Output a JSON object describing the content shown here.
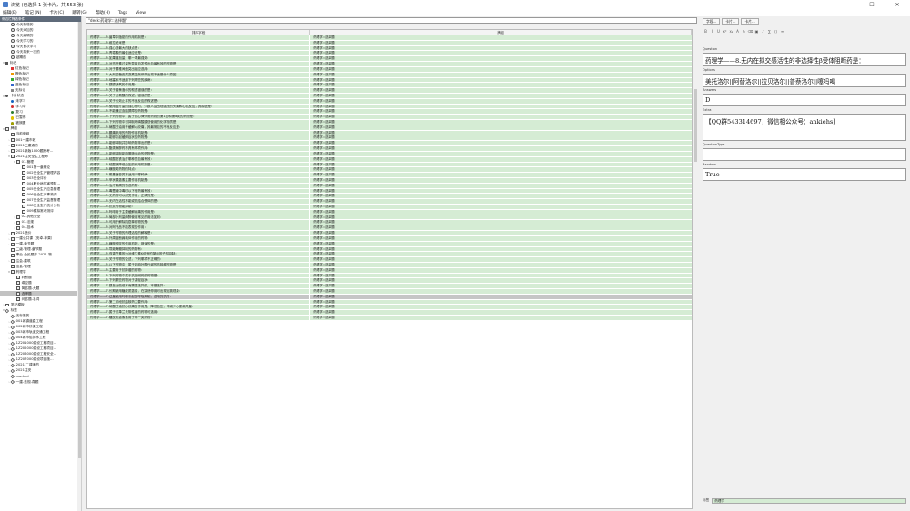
{
  "window": {
    "title": "浏览 (已选择 1 张卡片，共 553 张)",
    "min": "—",
    "max": "☐",
    "close": "✕"
  },
  "menu": [
    "编辑(E)",
    "笔记 (N)",
    "卡片(C)",
    "跳转(G)",
    "帮助(H)",
    "Tags",
    "View"
  ],
  "sidebar": {
    "header": "侧边栏筛选条件",
    "items": [
      {
        "label": "今天新增的",
        "indent": 1,
        "icon": "clock",
        "exp": ""
      },
      {
        "label": "今天添加的",
        "indent": 1,
        "icon": "clock",
        "exp": ""
      },
      {
        "label": "今天编辑的",
        "indent": 1,
        "icon": "clock",
        "exp": ""
      },
      {
        "label": "今天学习的",
        "indent": 1,
        "icon": "clock",
        "exp": ""
      },
      {
        "label": "今天首次学习",
        "indent": 1,
        "icon": "clock",
        "exp": ""
      },
      {
        "label": "今天再来一次的",
        "indent": 1,
        "icon": "clock",
        "exp": ""
      },
      {
        "label": "超期的",
        "indent": 1,
        "icon": "clock",
        "exp": ""
      },
      {
        "label": "标记",
        "indent": 0,
        "icon": "flag",
        "exp": "▾"
      },
      {
        "label": "红色标记",
        "indent": 1,
        "icon": "flag",
        "exp": "",
        "color": "#d33"
      },
      {
        "label": "橙色标记",
        "indent": 1,
        "icon": "flag",
        "exp": "",
        "color": "#e90"
      },
      {
        "label": "绿色标记",
        "indent": 1,
        "icon": "flag",
        "exp": "",
        "color": "#3a3"
      },
      {
        "label": "蓝色标记",
        "indent": 1,
        "icon": "flag",
        "exp": "",
        "color": "#36c"
      },
      {
        "label": "无标记",
        "indent": 1,
        "icon": "flag",
        "exp": "",
        "color": "#888"
      },
      {
        "label": "卡片状态",
        "indent": 0,
        "icon": "dot",
        "exp": "▾",
        "color": "#555"
      },
      {
        "label": "未学习",
        "indent": 1,
        "icon": "dot",
        "exp": "",
        "color": "#1565c0"
      },
      {
        "label": "学习中",
        "indent": 1,
        "icon": "dot",
        "exp": "",
        "color": "#d32f2f"
      },
      {
        "label": "复习",
        "indent": 1,
        "icon": "dot",
        "exp": "",
        "color": "#2e7d32"
      },
      {
        "label": "已暂停",
        "indent": 1,
        "icon": "dot",
        "exp": "",
        "color": "#e0c000"
      },
      {
        "label": "被搁置",
        "indent": 1,
        "icon": "dot",
        "exp": "",
        "color": "#9e9e00"
      },
      {
        "label": "牌组",
        "indent": 0,
        "icon": "deck",
        "exp": "▾"
      },
      {
        "label": "当前牌组",
        "indent": 1,
        "icon": "deck",
        "exp": ""
      },
      {
        "label": "001一建市政",
        "indent": 1,
        "icon": "deck",
        "exp": "›"
      },
      {
        "label": "2021二建通的",
        "indent": 1,
        "icon": "deck",
        "exp": "›"
      },
      {
        "label": "2021新版1000题跨考…",
        "indent": 1,
        "icon": "deck",
        "exp": "›"
      },
      {
        "label": "2021注安全生工程师",
        "indent": 1,
        "icon": "deck",
        "exp": "▾"
      },
      {
        "label": "01-管理",
        "indent": 2,
        "icon": "deck",
        "exp": "▾"
      },
      {
        "label": "001第一章概论",
        "indent": 3,
        "icon": "deck",
        "exp": ""
      },
      {
        "label": "002安全生产管理内容",
        "indent": 3,
        "icon": "deck",
        "exp": ""
      },
      {
        "label": "003安全评价",
        "indent": 3,
        "icon": "deck",
        "exp": ""
      },
      {
        "label": "004职业病危害预防…",
        "indent": 3,
        "icon": "deck",
        "exp": ""
      },
      {
        "label": "005安全生产应急管理",
        "indent": 3,
        "icon": "deck",
        "exp": ""
      },
      {
        "label": "006安全生产事故调…",
        "indent": 3,
        "icon": "deck",
        "exp": ""
      },
      {
        "label": "007安全生产监督管理",
        "indent": 3,
        "icon": "deck",
        "exp": ""
      },
      {
        "label": "008安全生产统计分析",
        "indent": 3,
        "icon": "deck",
        "exp": ""
      },
      {
        "label": "009模拟常考测评",
        "indent": 3,
        "icon": "deck",
        "exp": ""
      },
      {
        "label": "02-其他安全",
        "indent": 2,
        "icon": "deck",
        "exp": "›"
      },
      {
        "label": "03-法规",
        "indent": 2,
        "icon": "deck",
        "exp": "›"
      },
      {
        "label": "04-技术",
        "indent": 2,
        "icon": "deck",
        "exp": "›"
      },
      {
        "label": "2021造价",
        "indent": 1,
        "icon": "deck",
        "exp": "›"
      },
      {
        "label": "一建公共课（安卓-苹果）",
        "indent": 1,
        "icon": "deck",
        "exp": "›"
      },
      {
        "label": "一建-章节题",
        "indent": 1,
        "icon": "deck",
        "exp": "›"
      },
      {
        "label": "二级-管理-章节题",
        "indent": 1,
        "icon": "deck",
        "exp": ""
      },
      {
        "label": "事业-全民题库-2021-物…",
        "indent": 1,
        "icon": "deck",
        "exp": ""
      },
      {
        "label": "注会-建筑",
        "indent": 1,
        "icon": "deck",
        "exp": "›"
      },
      {
        "label": "注会-管理",
        "indent": 1,
        "icon": "deck",
        "exp": ""
      },
      {
        "label": "药理学",
        "indent": 1,
        "icon": "deck",
        "exp": "▾"
      },
      {
        "label": "判断题",
        "indent": 2,
        "icon": "deck",
        "exp": ""
      },
      {
        "label": "填空题",
        "indent": 2,
        "icon": "deck",
        "exp": ""
      },
      {
        "label": "简答题-大题",
        "indent": 2,
        "icon": "deck",
        "exp": ""
      },
      {
        "label": "选择题",
        "indent": 2,
        "icon": "deck",
        "exp": "",
        "selected": true
      },
      {
        "label": "问答题-名词",
        "indent": 2,
        "icon": "deck",
        "exp": ""
      },
      {
        "label": "笔记模板",
        "indent": 0,
        "icon": "folder",
        "exp": "›"
      },
      {
        "label": "标签",
        "indent": 0,
        "icon": "tag",
        "exp": "▾"
      },
      {
        "label": "无标签的",
        "indent": 1,
        "icon": "tag",
        "exp": ""
      },
      {
        "label": "001城镇道路工程",
        "indent": 1,
        "icon": "tag",
        "exp": "›"
      },
      {
        "label": "002城市桥梁工程",
        "indent": 1,
        "icon": "tag",
        "exp": "›"
      },
      {
        "label": "003城市轨道交通工程",
        "indent": 1,
        "icon": "tag",
        "exp": "›"
      },
      {
        "label": "004城市给排水工程",
        "indent": 1,
        "icon": "tag",
        "exp": "›"
      },
      {
        "label": "1Z201000建设工程项目…",
        "indent": 1,
        "icon": "tag",
        "exp": "›"
      },
      {
        "label": "1Z202000建设工程项目…",
        "indent": 1,
        "icon": "tag",
        "exp": "›"
      },
      {
        "label": "1Z206000建设工程安全…",
        "indent": 1,
        "icon": "tag",
        "exp": "›"
      },
      {
        "label": "1Z207000建设项目施…",
        "indent": 1,
        "icon": "tag",
        "exp": "›"
      },
      {
        "label": "2021-二建通的",
        "indent": 1,
        "icon": "tag",
        "exp": "›"
      },
      {
        "label": "2021注安",
        "indent": 1,
        "icon": "tag",
        "exp": "›"
      },
      {
        "label": "marked",
        "indent": 1,
        "icon": "tag",
        "exp": ""
      },
      {
        "label": "一建-法规-真题",
        "indent": 1,
        "icon": "tag",
        "exp": "›"
      }
    ]
  },
  "search": {
    "value": "\"deck:药理学::选择题\""
  },
  "table": {
    "headers": [
      "排序字段",
      "牌组"
    ],
    "selected_index": 49,
    "rows": [
      [
        "药理学——5.菌草中脂肪的作用机制是：",
        "药理学::选择题"
      ],
      [
        "药理学——5.维拉帕米是：",
        "药理学::选择题"
      ],
      [
        "药理学——5.强心苷最大的缺点是：",
        "药理学::选择题"
      ],
      [
        "药理学——5.青霉素的最佳适应证是：",
        "药理学::选择题"
      ],
      [
        "药理学——5.如果增加量，哪一项最强效：",
        "药理学::选择题"
      ],
      [
        "药理学——5.对抗肝素过量所导致自发性出血最有效的药物是：",
        "药理学::选择题"
      ],
      [
        "药理学——5.对于腰椎间盘突出症应选用：",
        "药理学::选择题"
      ],
      [
        "药理学——5.大剂量糖皮质激素突然停药出现不适是什么原因：",
        "药理学::选择题"
      ],
      [
        "药理学——5.地塞米不适用下列哪些的疾病：",
        "药理学::选择题"
      ],
      [
        "药理学——5.胰腺缺氧的作用是：",
        "药理学::选择题"
      ],
      [
        "药理学——5.关于普萘洛尔的叙述错误的是：",
        "药理学::选择题"
      ],
      [
        "药理学——5.关于丝氨酸的叙述，错误的是：",
        "药理学::选择题"
      ],
      [
        "药理学——5.关于长效止平的不良反应的叙述是：",
        "药理学::选择题"
      ],
      [
        "药理学——5.使用治疗量的强心苷时，少数人会出现强烈的头痛和心肌反应，其原因是：",
        "药理学::选择题"
      ],
      [
        "药理学——5.不能通过血脑屏障的药物是：",
        "药理学::选择题"
      ],
      [
        "药理学——5.下列药物中，属于抗心律失常药物的第1类和第Ⅲ类的药物是：",
        "药理学::选择题"
      ],
      [
        "药理学——5.下列药物中可抑制环磷酸腺苷使用的化学物质是：",
        "药理学::选择题"
      ],
      [
        "药理学——5.硝酸甘油用于缓解心绞痛，其最常见的不良反应是：",
        "药理学::选择题"
      ],
      [
        "药理学——5.腰痛采用的药物作用机制是：",
        "药理学::选择题"
      ],
      [
        "药理学——5.能够引起缓解症状的药物是：",
        "药理学::选择题"
      ],
      [
        "药理学——5.能够抑制并影响药物排出的是：",
        "药理学::选择题"
      ],
      [
        "药理学——5.酯类麻醉药不具有哪项作用：",
        "药理学::选择题"
      ],
      [
        "药理学——5.能够抑制影响胃肠运动的药物是：",
        "药理学::选择题"
      ],
      [
        "药理学——5.硫酸亚铁治疗哪种贫血最有效：",
        "药理学::选择题"
      ],
      [
        "药理学——5.硫酸镁降低血压的作用机制是：",
        "药理学::选择题"
      ],
      [
        "药理学——5.磺胺类药物的特点：",
        "药理学::选择题"
      ],
      [
        "药理学——5.氨基糖苷类不适用于哪种病：",
        "药理学::选择题"
      ],
      [
        "药理学——5.甲状腺激素主要作用机制是：",
        "药理学::选择题"
      ],
      [
        "药理学——5.治疗癫痫的首选药物：",
        "药理学::选择题"
      ],
      [
        "药理学——5.毒蕈碱中毒时以下何药最有效：",
        "药理学::选择题"
      ],
      [
        "药理学——5.无药物可以耐受作用，正确的是：",
        "药理学::选择题"
      ],
      [
        "药理学——5.无内在活性不能或抗结合受体的是：",
        "药理学::选择题"
      ],
      [
        "药理学——5.抗炎药物能抑制：",
        "药理学::选择题"
      ],
      [
        "药理学——5.吗啡用于主要缓解疼痛的作用是：",
        "药理学::选择题"
      ],
      [
        "药理学——5.局部小剂量麻醉使用常见的用法如何：",
        "药理学::选择题"
      ],
      [
        "药理学——5.可用于解除肌痉挛药物的是：",
        "药理学::选择题"
      ],
      [
        "药理学——5.对阿托品不能表现的作用：",
        "药理学::选择题"
      ],
      [
        "药理学——5.关于药物的药理活性的解释是：",
        "药理学::选择题"
      ],
      [
        "药理学——5.外周阻断扁桃体作用的药物：",
        "药理学::选择题"
      ],
      [
        "药理学——5.磺胺嘧啶的作用机制，错误的是：",
        "药理学::选择题"
      ],
      [
        "药理学——5.导致骨髓抑制的药物有：",
        "药理学::选择题"
      ],
      [
        "药理学——5.双香豆素因为对维生素K依赖的凝血因子的抑制：",
        "药理学::选择题"
      ],
      [
        "药理学——5.关于药物的论述，下列哪项不正确的：",
        "药理学::选择题"
      ],
      [
        "药理学——5.以下药物中，属于影响叶酸代谢的抗肿瘤药物是：",
        "药理学::选择题"
      ],
      [
        "药理学——5.主要用于抗肿瘤的药物：",
        "药理学::选择题"
      ],
      [
        "药理学——5.下列药物中属于抗胆碱药的药物是：",
        "药理学::选择题"
      ],
      [
        "药理学——5.下列哪些药物对于减轻症状：",
        "药理学::选择题"
      ],
      [
        "药理学——7.胰岛功能低下而需要选择的，不是选择：",
        "药理学::选择题"
      ],
      [
        "药理学——7.长期使用糖皮质激素，在突然停用可出现反跳现象：",
        "药理学::选择题"
      ],
      [
        "药理学——7.过量使用吗啡引起的呼吸抑制，选用的抗药：",
        "药理学::选择题"
      ],
      [
        "药理学——7.第二阶段抗结核药主要作用：",
        "药理学::选择题"
      ],
      [
        "药理学——7.硝酸甘油抗心绞痛的作用是，降低血压，并减少心肌耗氧量：",
        "药理学::选择题"
      ],
      [
        "药理学——7.属于抗革兰氏阴性菌的药物可选用：",
        "药理学::选择题"
      ],
      [
        "药理学——7.糖皮质激素常用于哪一类药物：",
        "药理学::选择题"
      ]
    ]
  },
  "editor": {
    "buttons": [
      "字段...",
      "卡片...",
      "卡片..."
    ],
    "format": [
      "B",
      "I",
      "U",
      "x²",
      "x₂",
      "A",
      "✎",
      "⌫",
      "▣",
      "♪",
      "∑",
      "⟨⟩",
      "≡"
    ],
    "fields": [
      {
        "label": "Question",
        "value": "药理学——8.无内在拟交感活性的非选择性β受体阻断药是："
      },
      {
        "label": "Options",
        "value": "美托洛尔||阿替洛尔||拉贝洛尔||普萘洛尔||噻吗喝"
      },
      {
        "label": "Answers",
        "value": "D"
      },
      {
        "label": "Extra",
        "value": "【QQ群543314697，微信相公众号：ankiehs】"
      },
      {
        "label": "QuestionType",
        "value": ""
      },
      {
        "label": "Random",
        "value": "True"
      }
    ],
    "tags_label": "标签",
    "tags_value": "药理学"
  }
}
